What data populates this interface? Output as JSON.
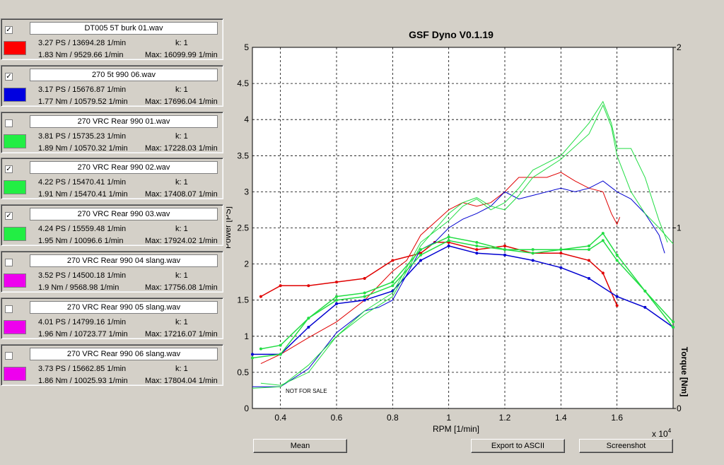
{
  "runs": [
    {
      "file": "DT005 5T burk 01.wav",
      "checked": true,
      "color": "#ff0000",
      "line1": "3.27 PS / 13694.28 1/min",
      "k": "k: 1",
      "line2": "1.83 Nm / 9529.66 1/min",
      "max": "Max: 16099.99 1/min"
    },
    {
      "file": "270 5t 990 06.wav",
      "checked": true,
      "color": "#0000e0",
      "line1": "3.17 PS / 15676.87 1/min",
      "k": "k: 1",
      "line2": "1.77 Nm / 10579.52 1/min",
      "max": "Max: 17696.04 1/min"
    },
    {
      "file": "270 VRC Rear 990 01.wav",
      "checked": false,
      "color": "#22ee44",
      "line1": "3.81 PS / 15735.23 1/min",
      "k": "k: 1",
      "line2": "1.89 Nm / 10570.32 1/min",
      "max": "Max: 17228.03 1/min"
    },
    {
      "file": "270 VRC Rear 990 02.wav",
      "checked": true,
      "color": "#22ee44",
      "line1": "4.22 PS / 15470.41 1/min",
      "k": "k: 1",
      "line2": "1.91 Nm / 15470.41 1/min",
      "max": "Max: 17408.07 1/min"
    },
    {
      "file": "270 VRC Rear 990 03.wav",
      "checked": true,
      "color": "#22ee44",
      "line1": "4.24 PS / 15559.48 1/min",
      "k": "k: 1",
      "line2": "1.95 Nm / 10096.6 1/min",
      "max": "Max: 17924.02 1/min"
    },
    {
      "file": "270 VRC Rear 990 04 slang.wav",
      "checked": false,
      "color": "#ee00ee",
      "line1": "3.52 PS / 14500.18 1/min",
      "k": "k: 1",
      "line2": "1.9 Nm / 9568.98 1/min",
      "max": "Max: 17756.08 1/min"
    },
    {
      "file": "270 VRC Rear 990 05 slang.wav",
      "checked": false,
      "color": "#ee00ee",
      "line1": "4.01 PS / 14799.16 1/min",
      "k": "k: 1",
      "line2": "1.96 Nm / 10723.77 1/min",
      "max": "Max: 17216.07 1/min"
    },
    {
      "file": "270 VRC Rear 990 06 slang.wav",
      "checked": false,
      "color": "#ee00ee",
      "line1": "3.73 PS / 15662.85 1/min",
      "k": "k: 1",
      "line2": "1.86 Nm / 10025.93 1/min",
      "max": "Max: 17804.04 1/min"
    }
  ],
  "buttons": {
    "mean": "Mean",
    "export": "Export to ASCII",
    "screenshot": "Screenshot"
  },
  "chart_data": {
    "type": "line",
    "title": "GSF Dyno V0.1.19",
    "xlabel": "RPM [1/min]",
    "ylabel": "Power [PS]",
    "y2label": "Torque [Nm]",
    "x_multiplier": "x 10",
    "x_multiplier_exp": "4",
    "watermark": "NOT FOR SALE",
    "xlim": [
      0.3,
      1.8
    ],
    "ylim": [
      0,
      5
    ],
    "y2lim": [
      0,
      2
    ],
    "xticks": [
      0.4,
      0.6,
      0.8,
      1,
      1.2,
      1.4,
      1.6
    ],
    "yticks": [
      0,
      0.5,
      1,
      1.5,
      2,
      2.5,
      3,
      3.5,
      4,
      4.5,
      5
    ],
    "y2ticks": [
      0,
      1,
      2
    ],
    "grid": true,
    "series": [
      {
        "color": "#e00000",
        "power": [
          [
            0.33,
            0.62
          ],
          [
            0.4,
            0.75
          ],
          [
            0.5,
            0.98
          ],
          [
            0.6,
            1.2
          ],
          [
            0.7,
            1.5
          ],
          [
            0.8,
            1.9
          ],
          [
            0.85,
            2.05
          ],
          [
            0.9,
            2.4
          ],
          [
            1.0,
            2.75
          ],
          [
            1.05,
            2.85
          ],
          [
            1.1,
            2.8
          ],
          [
            1.15,
            2.85
          ],
          [
            1.2,
            3.0
          ],
          [
            1.25,
            3.2
          ],
          [
            1.3,
            3.2
          ],
          [
            1.35,
            3.2
          ],
          [
            1.4,
            3.27
          ],
          [
            1.45,
            3.15
          ],
          [
            1.5,
            3.05
          ],
          [
            1.55,
            3.0
          ],
          [
            1.58,
            2.7
          ],
          [
            1.6,
            2.55
          ],
          [
            1.61,
            2.65
          ]
        ],
        "torque": [
          [
            0.33,
            0.62
          ],
          [
            0.4,
            0.68
          ],
          [
            0.5,
            0.68
          ],
          [
            0.6,
            0.7
          ],
          [
            0.7,
            0.72
          ],
          [
            0.8,
            0.82
          ],
          [
            0.9,
            0.86
          ],
          [
            0.95,
            0.92
          ],
          [
            1.0,
            0.92
          ],
          [
            1.1,
            0.88
          ],
          [
            1.2,
            0.9
          ],
          [
            1.3,
            0.86
          ],
          [
            1.4,
            0.86
          ],
          [
            1.5,
            0.82
          ],
          [
            1.55,
            0.75
          ],
          [
            1.6,
            0.57
          ]
        ]
      },
      {
        "color": "#0000d0",
        "power": [
          [
            0.3,
            0.3
          ],
          [
            0.4,
            0.3
          ],
          [
            0.5,
            0.55
          ],
          [
            0.6,
            1.05
          ],
          [
            0.7,
            1.35
          ],
          [
            0.75,
            1.4
          ],
          [
            0.8,
            1.5
          ],
          [
            0.9,
            2.2
          ],
          [
            0.95,
            2.3
          ],
          [
            1.0,
            2.5
          ],
          [
            1.05,
            2.62
          ],
          [
            1.1,
            2.7
          ],
          [
            1.15,
            2.8
          ],
          [
            1.2,
            3.0
          ],
          [
            1.25,
            2.9
          ],
          [
            1.3,
            2.95
          ],
          [
            1.4,
            3.05
          ],
          [
            1.45,
            3.0
          ],
          [
            1.5,
            3.05
          ],
          [
            1.55,
            3.15
          ],
          [
            1.6,
            3.0
          ],
          [
            1.65,
            2.9
          ],
          [
            1.7,
            2.7
          ],
          [
            1.75,
            2.4
          ],
          [
            1.77,
            2.15
          ]
        ],
        "torque": [
          [
            0.3,
            0.3
          ],
          [
            0.4,
            0.3
          ],
          [
            0.5,
            0.45
          ],
          [
            0.6,
            0.58
          ],
          [
            0.7,
            0.6
          ],
          [
            0.8,
            0.65
          ],
          [
            0.9,
            0.82
          ],
          [
            1.0,
            0.9
          ],
          [
            1.1,
            0.86
          ],
          [
            1.2,
            0.85
          ],
          [
            1.3,
            0.82
          ],
          [
            1.4,
            0.78
          ],
          [
            1.5,
            0.72
          ],
          [
            1.6,
            0.62
          ],
          [
            1.7,
            0.56
          ],
          [
            1.8,
            0.45
          ]
        ]
      },
      {
        "color": "#22dd44",
        "power": [
          [
            0.3,
            0.28
          ],
          [
            0.4,
            0.3
          ],
          [
            0.5,
            0.6
          ],
          [
            0.6,
            1.0
          ],
          [
            0.7,
            1.3
          ],
          [
            0.8,
            1.55
          ],
          [
            0.9,
            2.25
          ],
          [
            1.0,
            2.7
          ],
          [
            1.05,
            2.85
          ],
          [
            1.1,
            2.92
          ],
          [
            1.15,
            2.8
          ],
          [
            1.2,
            2.75
          ],
          [
            1.25,
            2.95
          ],
          [
            1.3,
            3.2
          ],
          [
            1.4,
            3.45
          ],
          [
            1.5,
            3.8
          ],
          [
            1.55,
            4.2
          ],
          [
            1.58,
            3.9
          ],
          [
            1.6,
            3.5
          ],
          [
            1.65,
            3.0
          ],
          [
            1.7,
            2.7
          ],
          [
            1.75,
            2.5
          ],
          [
            1.8,
            2.28
          ]
        ],
        "torque": [
          [
            0.3,
            0.28
          ],
          [
            0.4,
            0.3
          ],
          [
            0.5,
            0.5
          ],
          [
            0.6,
            0.6
          ],
          [
            0.7,
            0.62
          ],
          [
            0.8,
            0.68
          ],
          [
            0.9,
            0.85
          ],
          [
            1.0,
            0.93
          ],
          [
            1.1,
            0.9
          ],
          [
            1.2,
            0.88
          ],
          [
            1.3,
            0.88
          ],
          [
            1.4,
            0.88
          ],
          [
            1.5,
            0.88
          ],
          [
            1.55,
            0.93
          ],
          [
            1.6,
            0.82
          ],
          [
            1.7,
            0.65
          ],
          [
            1.8,
            0.45
          ]
        ]
      },
      {
        "color": "#22dd44",
        "power": [
          [
            0.33,
            0.35
          ],
          [
            0.4,
            0.32
          ],
          [
            0.5,
            0.5
          ],
          [
            0.6,
            1.0
          ],
          [
            0.7,
            1.35
          ],
          [
            0.8,
            1.6
          ],
          [
            0.9,
            2.3
          ],
          [
            1.0,
            2.6
          ],
          [
            1.05,
            2.8
          ],
          [
            1.1,
            2.9
          ],
          [
            1.15,
            2.75
          ],
          [
            1.2,
            2.85
          ],
          [
            1.25,
            3.05
          ],
          [
            1.3,
            3.3
          ],
          [
            1.4,
            3.5
          ],
          [
            1.5,
            3.95
          ],
          [
            1.55,
            4.25
          ],
          [
            1.58,
            3.95
          ],
          [
            1.6,
            3.6
          ],
          [
            1.65,
            3.6
          ],
          [
            1.7,
            3.2
          ],
          [
            1.75,
            2.6
          ],
          [
            1.78,
            2.3
          ]
        ],
        "torque": [
          [
            0.33,
            0.33
          ],
          [
            0.4,
            0.35
          ],
          [
            0.5,
            0.5
          ],
          [
            0.6,
            0.62
          ],
          [
            0.7,
            0.64
          ],
          [
            0.8,
            0.7
          ],
          [
            0.9,
            0.88
          ],
          [
            1.0,
            0.95
          ],
          [
            1.1,
            0.92
          ],
          [
            1.2,
            0.88
          ],
          [
            1.3,
            0.86
          ],
          [
            1.4,
            0.88
          ],
          [
            1.5,
            0.9
          ],
          [
            1.55,
            0.97
          ],
          [
            1.6,
            0.85
          ],
          [
            1.7,
            0.65
          ],
          [
            1.8,
            0.48
          ]
        ]
      }
    ]
  }
}
